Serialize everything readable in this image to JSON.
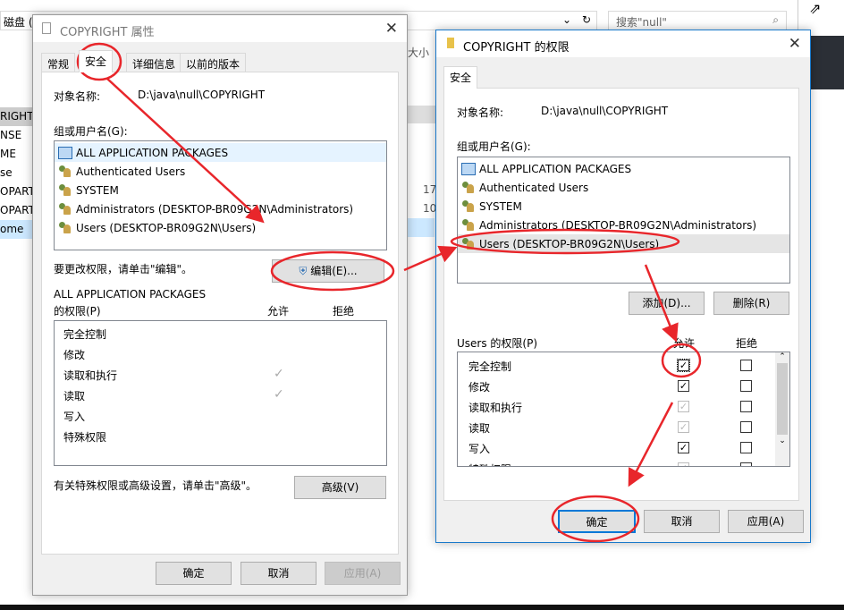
{
  "explorer": {
    "address": "磁盘 (",
    "search_placeholder": "搜索\"null\"",
    "size_header": "大小",
    "left_items": [
      "RIGHT",
      "NSE",
      "ME",
      "se",
      "OPART",
      "OPART",
      "ome"
    ],
    "sizes": [
      "17",
      "10"
    ]
  },
  "props": {
    "title": "COPYRIGHT 属性",
    "tabs": [
      "常规",
      "安全",
      "详细信息",
      "以前的版本"
    ],
    "object_label": "对象名称:",
    "object_value": "D:\\java\\null\\COPYRIGHT",
    "group_label": "组或用户名(G):",
    "users": [
      "ALL APPLICATION PACKAGES",
      "Authenticated Users",
      "SYSTEM",
      "Administrators (DESKTOP-BR09G2N\\Administrators)",
      "Users (DESKTOP-BR09G2N\\Users)"
    ],
    "change_hint": "要更改权限，请单击\"编辑\"。",
    "edit_button": "编辑(E)...",
    "perm_for": "ALL APPLICATION PACKAGES",
    "perm_label": "的权限(P)",
    "allow": "允许",
    "deny": "拒绝",
    "perms": [
      {
        "name": "完全控制",
        "allow": false
      },
      {
        "name": "修改",
        "allow": false
      },
      {
        "name": "读取和执行",
        "allow": true
      },
      {
        "name": "读取",
        "allow": true
      },
      {
        "name": "写入",
        "allow": false
      },
      {
        "name": "特殊权限",
        "allow": false
      }
    ],
    "advanced_hint": "有关特殊权限或高级设置，请单击\"高级\"。",
    "advanced_button": "高级(V)",
    "ok": "确定",
    "cancel": "取消",
    "apply": "应用(A)"
  },
  "perm_dialog": {
    "title": "COPYRIGHT 的权限",
    "tab": "安全",
    "object_label": "对象名称:",
    "object_value": "D:\\java\\null\\COPYRIGHT",
    "group_label": "组或用户名(G):",
    "users": [
      "ALL APPLICATION PACKAGES",
      "Authenticated Users",
      "SYSTEM",
      "Administrators (DESKTOP-BR09G2N\\Administrators)",
      "Users (DESKTOP-BR09G2N\\Users)"
    ],
    "selected_user": 4,
    "add_button": "添加(D)...",
    "remove_button": "删除(R)",
    "perm_label": "Users 的权限(P)",
    "allow": "允许",
    "deny": "拒绝",
    "perms": [
      {
        "name": "完全控制",
        "allow": "checked",
        "deny": false
      },
      {
        "name": "修改",
        "allow": "checked",
        "deny": false
      },
      {
        "name": "读取和执行",
        "allow": "inherited",
        "deny": false
      },
      {
        "name": "读取",
        "allow": "inherited",
        "deny": false
      },
      {
        "name": "写入",
        "allow": "checked",
        "deny": false
      },
      {
        "name": "特殊权限",
        "allow": "inherited",
        "deny": false
      }
    ],
    "ok": "确定",
    "cancel": "取消",
    "apply": "应用(A)"
  },
  "colors": {
    "annotation": "#e8262b",
    "focus": "#0078d7"
  }
}
